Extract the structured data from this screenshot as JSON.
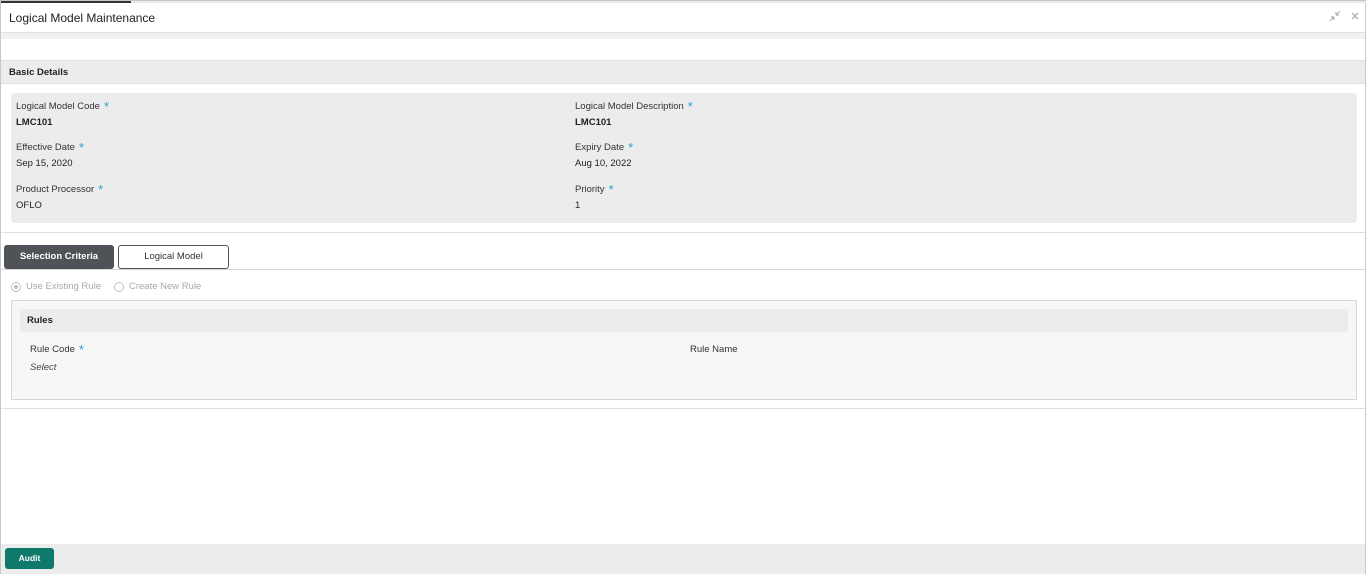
{
  "window": {
    "title": "Logical Model Maintenance"
  },
  "basic_details": {
    "heading": "Basic Details",
    "fields": [
      {
        "label": "Logical Model Code",
        "value": "LMC101",
        "required": true
      },
      {
        "label": "Logical Model Description",
        "value": "LMC101",
        "required": true
      },
      {
        "label": "Effective Date",
        "value": "Sep 15, 2020",
        "required": true
      },
      {
        "label": "Expiry Date",
        "value": "Aug 10, 2022",
        "required": true
      },
      {
        "label": "Product Processor",
        "value": "OFLO",
        "required": true
      },
      {
        "label": "Priority",
        "value": "1",
        "required": true
      }
    ],
    "required_mark": "*"
  },
  "tabs": [
    {
      "label": "Selection Criteria",
      "active": true
    },
    {
      "label": "Logical Model",
      "active": false
    }
  ],
  "rule_options": [
    {
      "label": "Use Existing Rule",
      "selected": true
    },
    {
      "label": "Create New Rule",
      "selected": false
    }
  ],
  "rules": {
    "heading": "Rules",
    "rule_code_label": "Rule Code",
    "rule_code_value": "Select",
    "rule_name_label": "Rule Name"
  },
  "footer": {
    "audit_label": "Audit"
  },
  "colors": {
    "accent": "#0f7a6c",
    "required": "#2a9fd6",
    "active_tab": "#4f5358"
  },
  "icons": {
    "minimize": "collapse-arrows-icon",
    "close": "close-icon"
  }
}
